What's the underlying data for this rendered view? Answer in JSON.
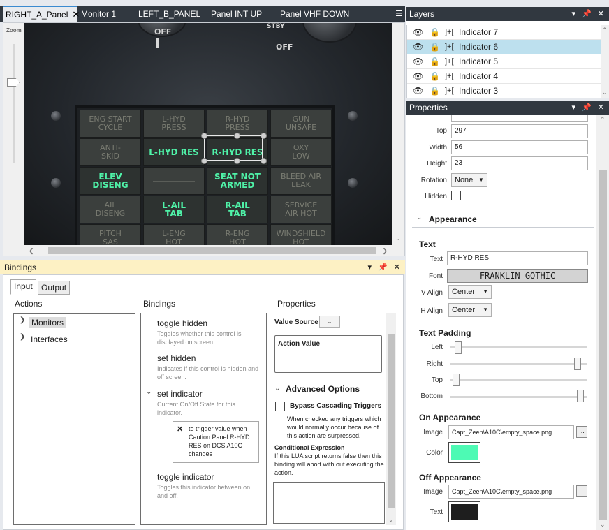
{
  "document_tabs": [
    {
      "label": "RIGHT_A_Panel",
      "active": true
    },
    {
      "label": "Monitor 1"
    },
    {
      "label": "LEFT_B_PANEL"
    },
    {
      "label": "Panel INT UP"
    },
    {
      "label": "Panel VHF DOWN"
    }
  ],
  "canvas": {
    "zoom_label": "Zoom",
    "engraving": {
      "off_left": "OFF",
      "off_right": "OFF",
      "stby": "STBY"
    },
    "annunciators": [
      [
        "ENG START\nCYCLE",
        "L-HYD\nPRESS",
        "R-HYD\nPRESS",
        "GUN\nUNSAFE"
      ],
      [
        "ANTI-\nSKID",
        "L-HYD  RES",
        "R-HYD  RES",
        "OXY\nLOW"
      ],
      [
        "ELEV\nDISENG",
        "",
        "SEAT  NOT\nARMED",
        "BLEED  AIR\nLEAK"
      ],
      [
        "AIL\nDISENG",
        "L-AIL\nTAB",
        "R-AIL\nTAB",
        "SERVICE\nAIR  HOT"
      ],
      [
        "PITCH\nSAS",
        "L-ENG\nHOT",
        "R-ENG\nHOT",
        "WINDSHIELD\nHOT"
      ]
    ]
  },
  "layers": {
    "title": "Layers",
    "items": [
      {
        "name": "Indicator 7"
      },
      {
        "name": "Indicator 6",
        "selected": true
      },
      {
        "name": "Indicator 5"
      },
      {
        "name": "Indicator 4"
      },
      {
        "name": "Indicator 3"
      }
    ]
  },
  "properties": {
    "title": "Properties",
    "top_label": "Top",
    "top": "297",
    "width_label": "Width",
    "width": "56",
    "height_label": "Height",
    "height": "23",
    "rotation_label": "Rotation",
    "rotation": "None",
    "hidden_label": "Hidden",
    "appearance_header": "Appearance",
    "text_header": "Text",
    "text_label": "Text",
    "text_value": "R-HYD RES",
    "font_label": "Font",
    "font_value": "FRANKLIN  GOTHIC",
    "valign_label": "V Align",
    "valign": "Center",
    "halign_label": "H Align",
    "halign": "Center",
    "padding_header": "Text Padding",
    "pad_left": "Left",
    "pad_right": "Right",
    "pad_top": "Top",
    "pad_bottom": "Bottom",
    "on_header": "On Appearance",
    "on_image_label": "Image",
    "on_image": "Capt_Zeen\\A10C\\empty_space.png",
    "on_color_label": "Color",
    "on_color": "#4dfab4",
    "off_header": "Off Appearance",
    "off_image_label": "Image",
    "off_image": "Capt_Zeen\\A10C\\empty_space.png",
    "off_text_label": "Text",
    "off_text_color": "#1e1e1e",
    "browse": "..."
  },
  "bindings": {
    "title": "Bindings",
    "tabs": [
      "Input",
      "Output"
    ],
    "actions_header": "Actions",
    "bindings_header": "Bindings",
    "properties_header": "Properties",
    "tree": [
      "Monitors",
      "Interfaces"
    ],
    "list": [
      {
        "name": "toggle hidden",
        "desc": "Toggles whether this control is displayed on screen."
      },
      {
        "name": "set hidden",
        "desc": "Indicates if this control is hidden and off screen."
      },
      {
        "name": "set indicator",
        "desc": "Current On/Off State for this indicator."
      },
      {
        "name": "toggle indicator",
        "desc": "Toggles this indicator between on and off."
      }
    ],
    "trigger_text": "to trigger value when Caution Panel R-HYD RES on DCS A10C changes",
    "value_source_label": "Value Source",
    "action_value_label": "Action Value",
    "advanced_header": "Advanced Options",
    "bypass_label": "Bypass Cascading Triggers",
    "bypass_desc": "When checked any triggers which would normally occur because of this action are surpressed.",
    "cond_header": "Conditional Expression",
    "cond_desc": "If this LUA script returns false then this binding will abort with out executing the action."
  }
}
